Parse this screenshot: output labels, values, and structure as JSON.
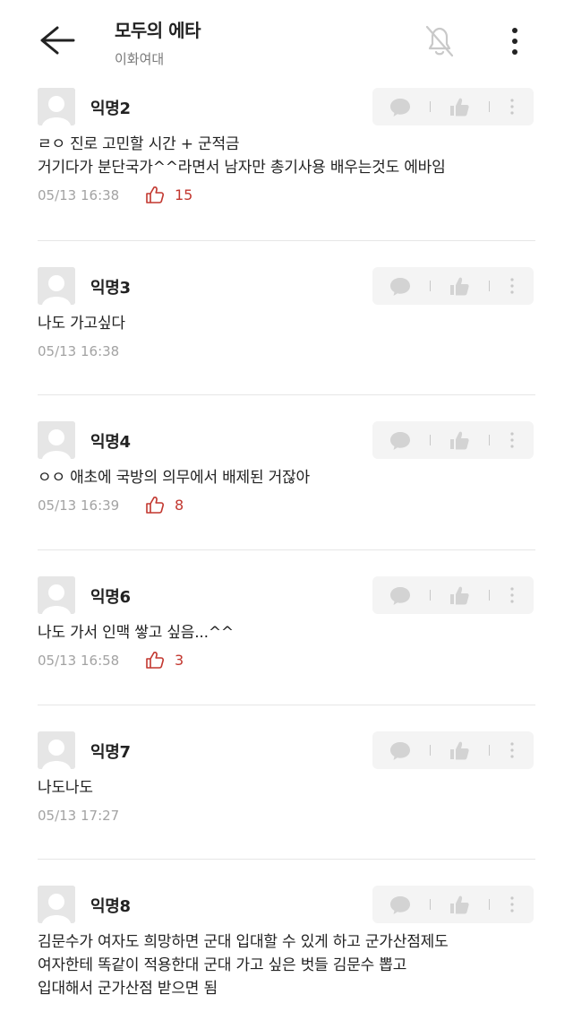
{
  "header": {
    "title": "모두의 에타",
    "subtitle": "이화여대",
    "icons": [
      "back-arrow-icon",
      "bell-off-icon",
      "more-vertical-icon"
    ]
  },
  "comments": [
    {
      "author": "익명2",
      "lines": [
        "ㄹㅇ 진로 고민할 시간 + 군적금",
        "거기다가 분단국가^^라면서 남자만 총기사용 배우는것도 에바임"
      ],
      "time": "05/13 16:38",
      "likes": "15"
    },
    {
      "author": "익명3",
      "lines": [
        "나도 가고싶다"
      ],
      "time": "05/13 16:38",
      "likes": ""
    },
    {
      "author": "익명4",
      "lines": [
        "ㅇㅇ 애초에 국방의 의무에서 배제된 거잖아"
      ],
      "time": "05/13 16:39",
      "likes": "8"
    },
    {
      "author": "익명6",
      "lines": [
        "나도 가서 인맥 쌓고 싶음...^^"
      ],
      "time": "05/13 16:58",
      "likes": "3"
    },
    {
      "author": "익명7",
      "lines": [
        "나도나도"
      ],
      "time": "05/13 17:27",
      "likes": ""
    },
    {
      "author": "익명8",
      "lines": [
        "김문수가 여자도 희망하면 군대 입대할 수 있게 하고 군가산점제도",
        "여자한테 똑같이 적용한대 군대 가고 싶은 벗들 김문수 뽑고",
        "입대해서 군가산점 받으면 됨"
      ],
      "time": "",
      "likes": ""
    }
  ],
  "colors": {
    "like_accent": "#c2372f",
    "meta_text": "#a3a3a3",
    "action_bg": "#f4f4f4"
  }
}
